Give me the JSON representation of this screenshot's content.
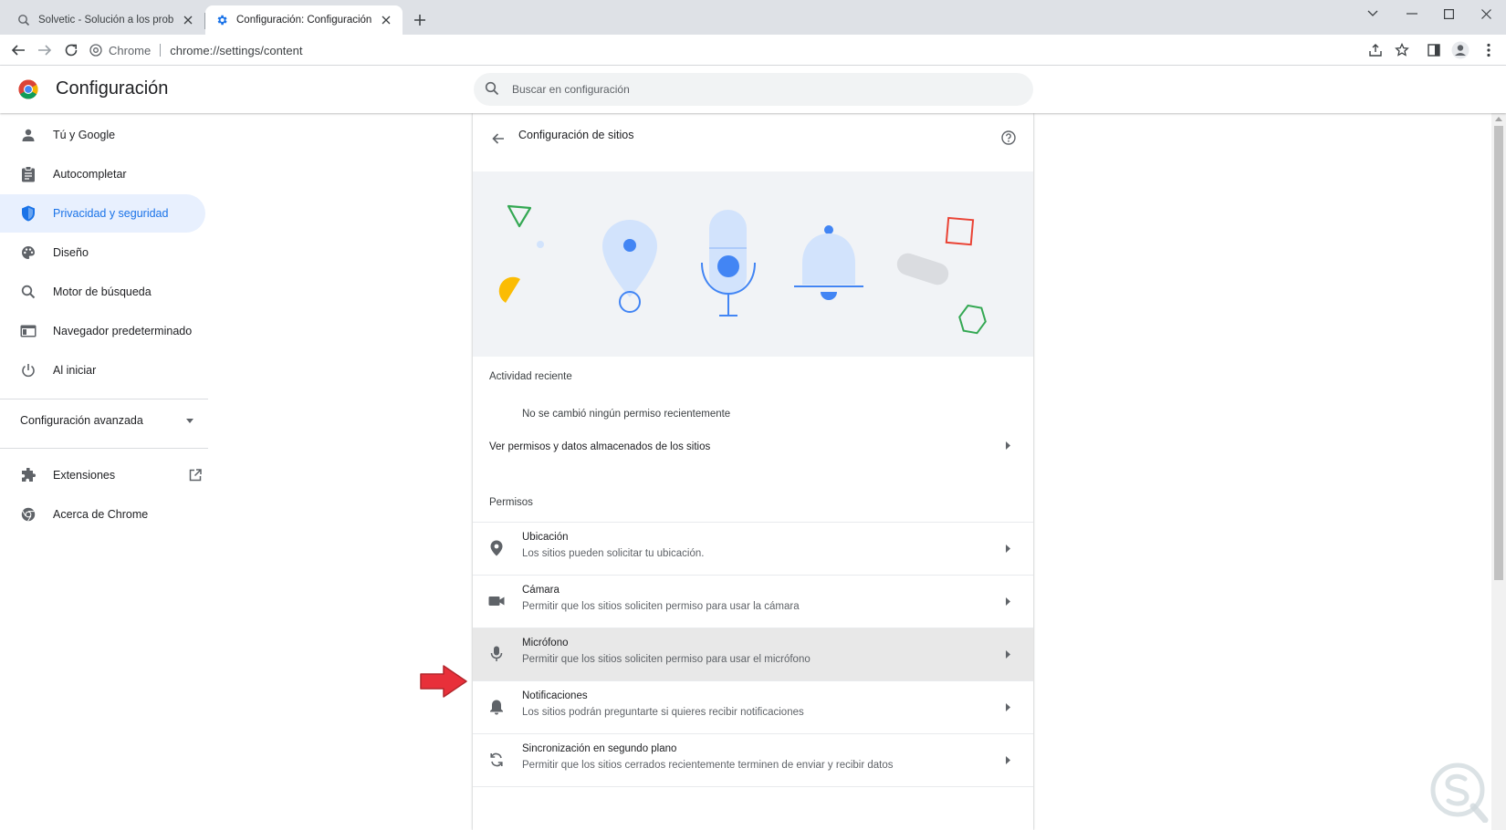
{
  "browser": {
    "tabs": [
      {
        "title": "Solvetic - Solución a los problemas",
        "icon": "search-favicon"
      },
      {
        "title": "Configuración: Configuración de sitios",
        "icon": "gear-favicon"
      }
    ],
    "omnibox": {
      "site_label": "Chrome",
      "url": "chrome://settings/content"
    }
  },
  "settings": {
    "title": "Configuración",
    "search_placeholder": "Buscar en configuración"
  },
  "sidebar": {
    "items": [
      {
        "label": "Tú y Google",
        "icon": "person-icon"
      },
      {
        "label": "Autocompletar",
        "icon": "clipboard-icon"
      },
      {
        "label": "Privacidad y seguridad",
        "icon": "shield-icon",
        "selected": true
      },
      {
        "label": "Diseño",
        "icon": "palette-icon"
      },
      {
        "label": "Motor de búsqueda",
        "icon": "search-icon"
      },
      {
        "label": "Navegador predeterminado",
        "icon": "browser-icon"
      },
      {
        "label": "Al iniciar",
        "icon": "power-icon"
      }
    ],
    "advanced_label": "Configuración avanzada",
    "extensions_label": "Extensiones",
    "about_label": "Acerca de Chrome"
  },
  "main": {
    "title": "Configuración de sitios",
    "recent_activity_label": "Actividad reciente",
    "no_recent_changes": "No se cambió ningún permiso recientemente",
    "view_permissions_link": "Ver permisos y datos almacenados de los sitios",
    "permissions_label": "Permisos",
    "permissions": [
      {
        "title": "Ubicación",
        "subtitle": "Los sitios pueden solicitar tu ubicación.",
        "icon": "location-icon"
      },
      {
        "title": "Cámara",
        "subtitle": "Permitir que los sitios soliciten permiso para usar la cámara",
        "icon": "camera-icon"
      },
      {
        "title": "Micrófono",
        "subtitle": "Permitir que los sitios soliciten permiso para usar el micrófono",
        "icon": "microphone-icon",
        "highlighted": true
      },
      {
        "title": "Notificaciones",
        "subtitle": "Los sitios podrán preguntarte si quieres recibir notificaciones",
        "icon": "bell-icon"
      },
      {
        "title": "Sincronización en segundo plano",
        "subtitle": "Permitir que los sitios cerrados recientemente terminen de enviar y recibir datos",
        "icon": "sync-icon"
      }
    ]
  },
  "colors": {
    "accent": "#1a73e8",
    "selected_bg": "#e8f0fe",
    "highlight_row": "#e8e8e8",
    "annotation_arrow": "#e8303a"
  }
}
